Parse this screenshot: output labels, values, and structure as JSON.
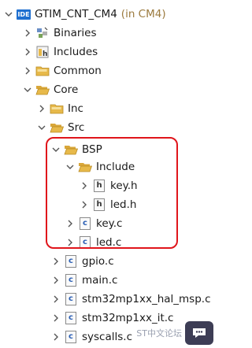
{
  "project": {
    "name": "GTIM_CNT_CM4",
    "context": "(in CM4)",
    "badge": "IDE"
  },
  "tree": [
    {
      "label": "Binaries",
      "icon": "binaries-icon",
      "expanded": false
    },
    {
      "label": "Includes",
      "icon": "includes-icon",
      "expanded": false
    },
    {
      "label": "Common",
      "icon": "folder-icon",
      "expanded": false
    },
    {
      "label": "Core",
      "icon": "folder-icon",
      "expanded": true
    },
    {
      "label": "Inc",
      "icon": "folder-icon",
      "expanded": false
    },
    {
      "label": "Src",
      "icon": "folder-icon",
      "expanded": true
    },
    {
      "label": "BSP",
      "icon": "folder-icon",
      "expanded": true
    },
    {
      "label": "Include",
      "icon": "folder-icon",
      "expanded": true
    },
    {
      "label": "key.h",
      "icon": "header-file-icon",
      "expanded": false
    },
    {
      "label": "led.h",
      "icon": "header-file-icon",
      "expanded": false
    },
    {
      "label": "key.c",
      "icon": "c-file-icon",
      "expanded": false
    },
    {
      "label": "led.c",
      "icon": "c-file-icon",
      "expanded": false
    },
    {
      "label": "gpio.c",
      "icon": "c-file-icon",
      "expanded": false
    },
    {
      "label": "main.c",
      "icon": "c-file-icon",
      "expanded": false
    },
    {
      "label": "stm32mp1xx_hal_msp.c",
      "icon": "c-file-icon",
      "expanded": false
    },
    {
      "label": "stm32mp1xx_it.c",
      "icon": "c-file-icon",
      "expanded": false
    },
    {
      "label": "syscalls.c",
      "icon": "c-file-icon",
      "expanded": false
    }
  ],
  "watermark": {
    "text": "ST中文论坛"
  },
  "colors": {
    "highlight": "#e0151b",
    "folder": "#e7b94a",
    "ide_badge": "#1e6fd0"
  }
}
